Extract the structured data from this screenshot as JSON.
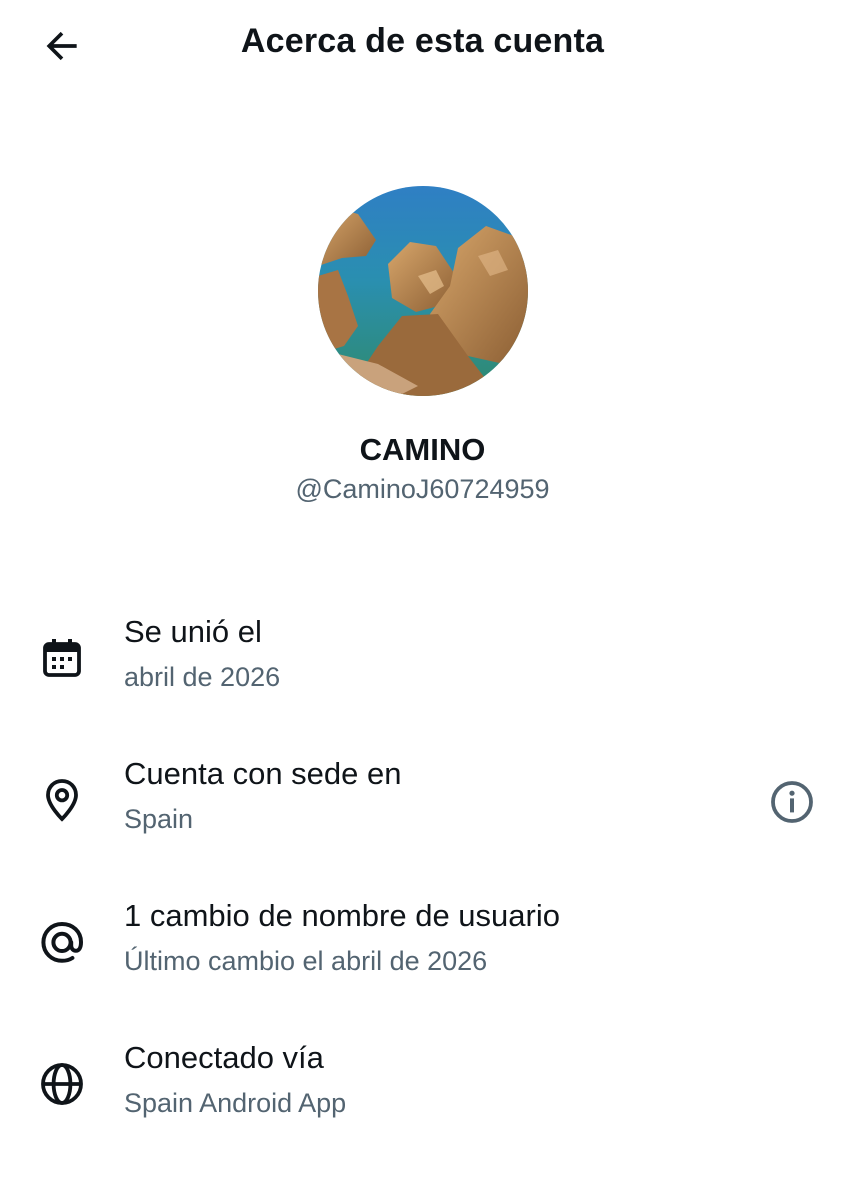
{
  "header": {
    "title": "Acerca de esta cuenta",
    "back_icon": "arrow-left-icon"
  },
  "profile": {
    "display_name": "CAMINO",
    "handle": "@CaminoJ60724959",
    "avatar_description": "coastal-rocks-photo"
  },
  "details": [
    {
      "icon": "calendar-icon",
      "title": "Se unió el",
      "subtitle": "abril de 2026"
    },
    {
      "icon": "location-pin-icon",
      "title": "Cuenta con sede en",
      "subtitle": "Spain",
      "action_icon": "info-icon"
    },
    {
      "icon": "at-sign-icon",
      "title": "1 cambio de nombre de usuario",
      "subtitle": "Último cambio el abril de 2026"
    },
    {
      "icon": "globe-icon",
      "title": "Conectado vía",
      "subtitle": "Spain Android App"
    }
  ],
  "colors": {
    "primary_text": "#0f1419",
    "secondary_text": "#536471",
    "background": "#ffffff"
  }
}
